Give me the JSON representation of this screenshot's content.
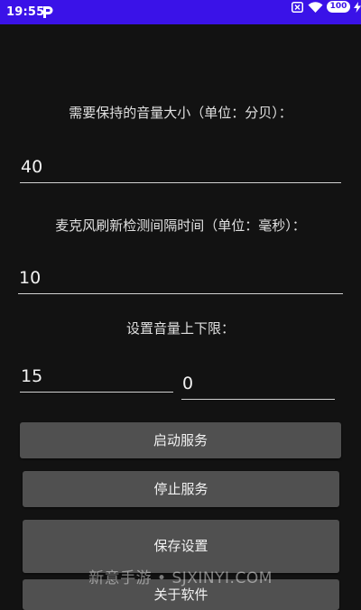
{
  "status_bar": {
    "time": "19:55",
    "battery": "100"
  },
  "settings": {
    "volume_label": "需要保持的音量大小（单位：分贝）：",
    "volume_value": "40",
    "interval_label": "麦克风刷新检测间隔时间（单位：毫秒）：",
    "interval_value": "10",
    "limit_label": "设置音量上下限：",
    "limit_upper": "15",
    "limit_lower": "0"
  },
  "buttons": {
    "start": "启动服务",
    "stop": "停止服务",
    "save": "保存设置",
    "about": "关于软件"
  },
  "watermark": "新意手游 • SJXINYI.COM",
  "colors": {
    "status_bar": "#3a12e8",
    "background": "#121212",
    "button": "#505050"
  }
}
